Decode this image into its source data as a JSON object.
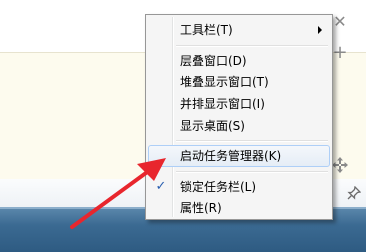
{
  "menu": {
    "items": [
      {
        "label": "工具栏(T)",
        "has_submenu": true
      },
      {
        "label": "层叠窗口(D)"
      },
      {
        "label": "堆叠显示窗口(T)"
      },
      {
        "label": "并排显示窗口(I)"
      },
      {
        "label": "显示桌面(S)"
      },
      {
        "label": "启动任务管理器(K)",
        "highlighted": true
      },
      {
        "label": "锁定任务栏(L)",
        "checked": true
      },
      {
        "label": "属性(R)"
      }
    ]
  },
  "icons": {
    "close": "close-icon",
    "add": "plus-icon",
    "move": "move-icon",
    "pin": "pin-icon",
    "check": "checkmark-icon",
    "annotation": "red-arrow"
  },
  "colors": {
    "taskbar": "#3b6a92",
    "menu_background": "#f5f5f5",
    "highlight_border": "#aecff7",
    "annotation_arrow": "#e8262d",
    "check": "#2a5fb0"
  }
}
